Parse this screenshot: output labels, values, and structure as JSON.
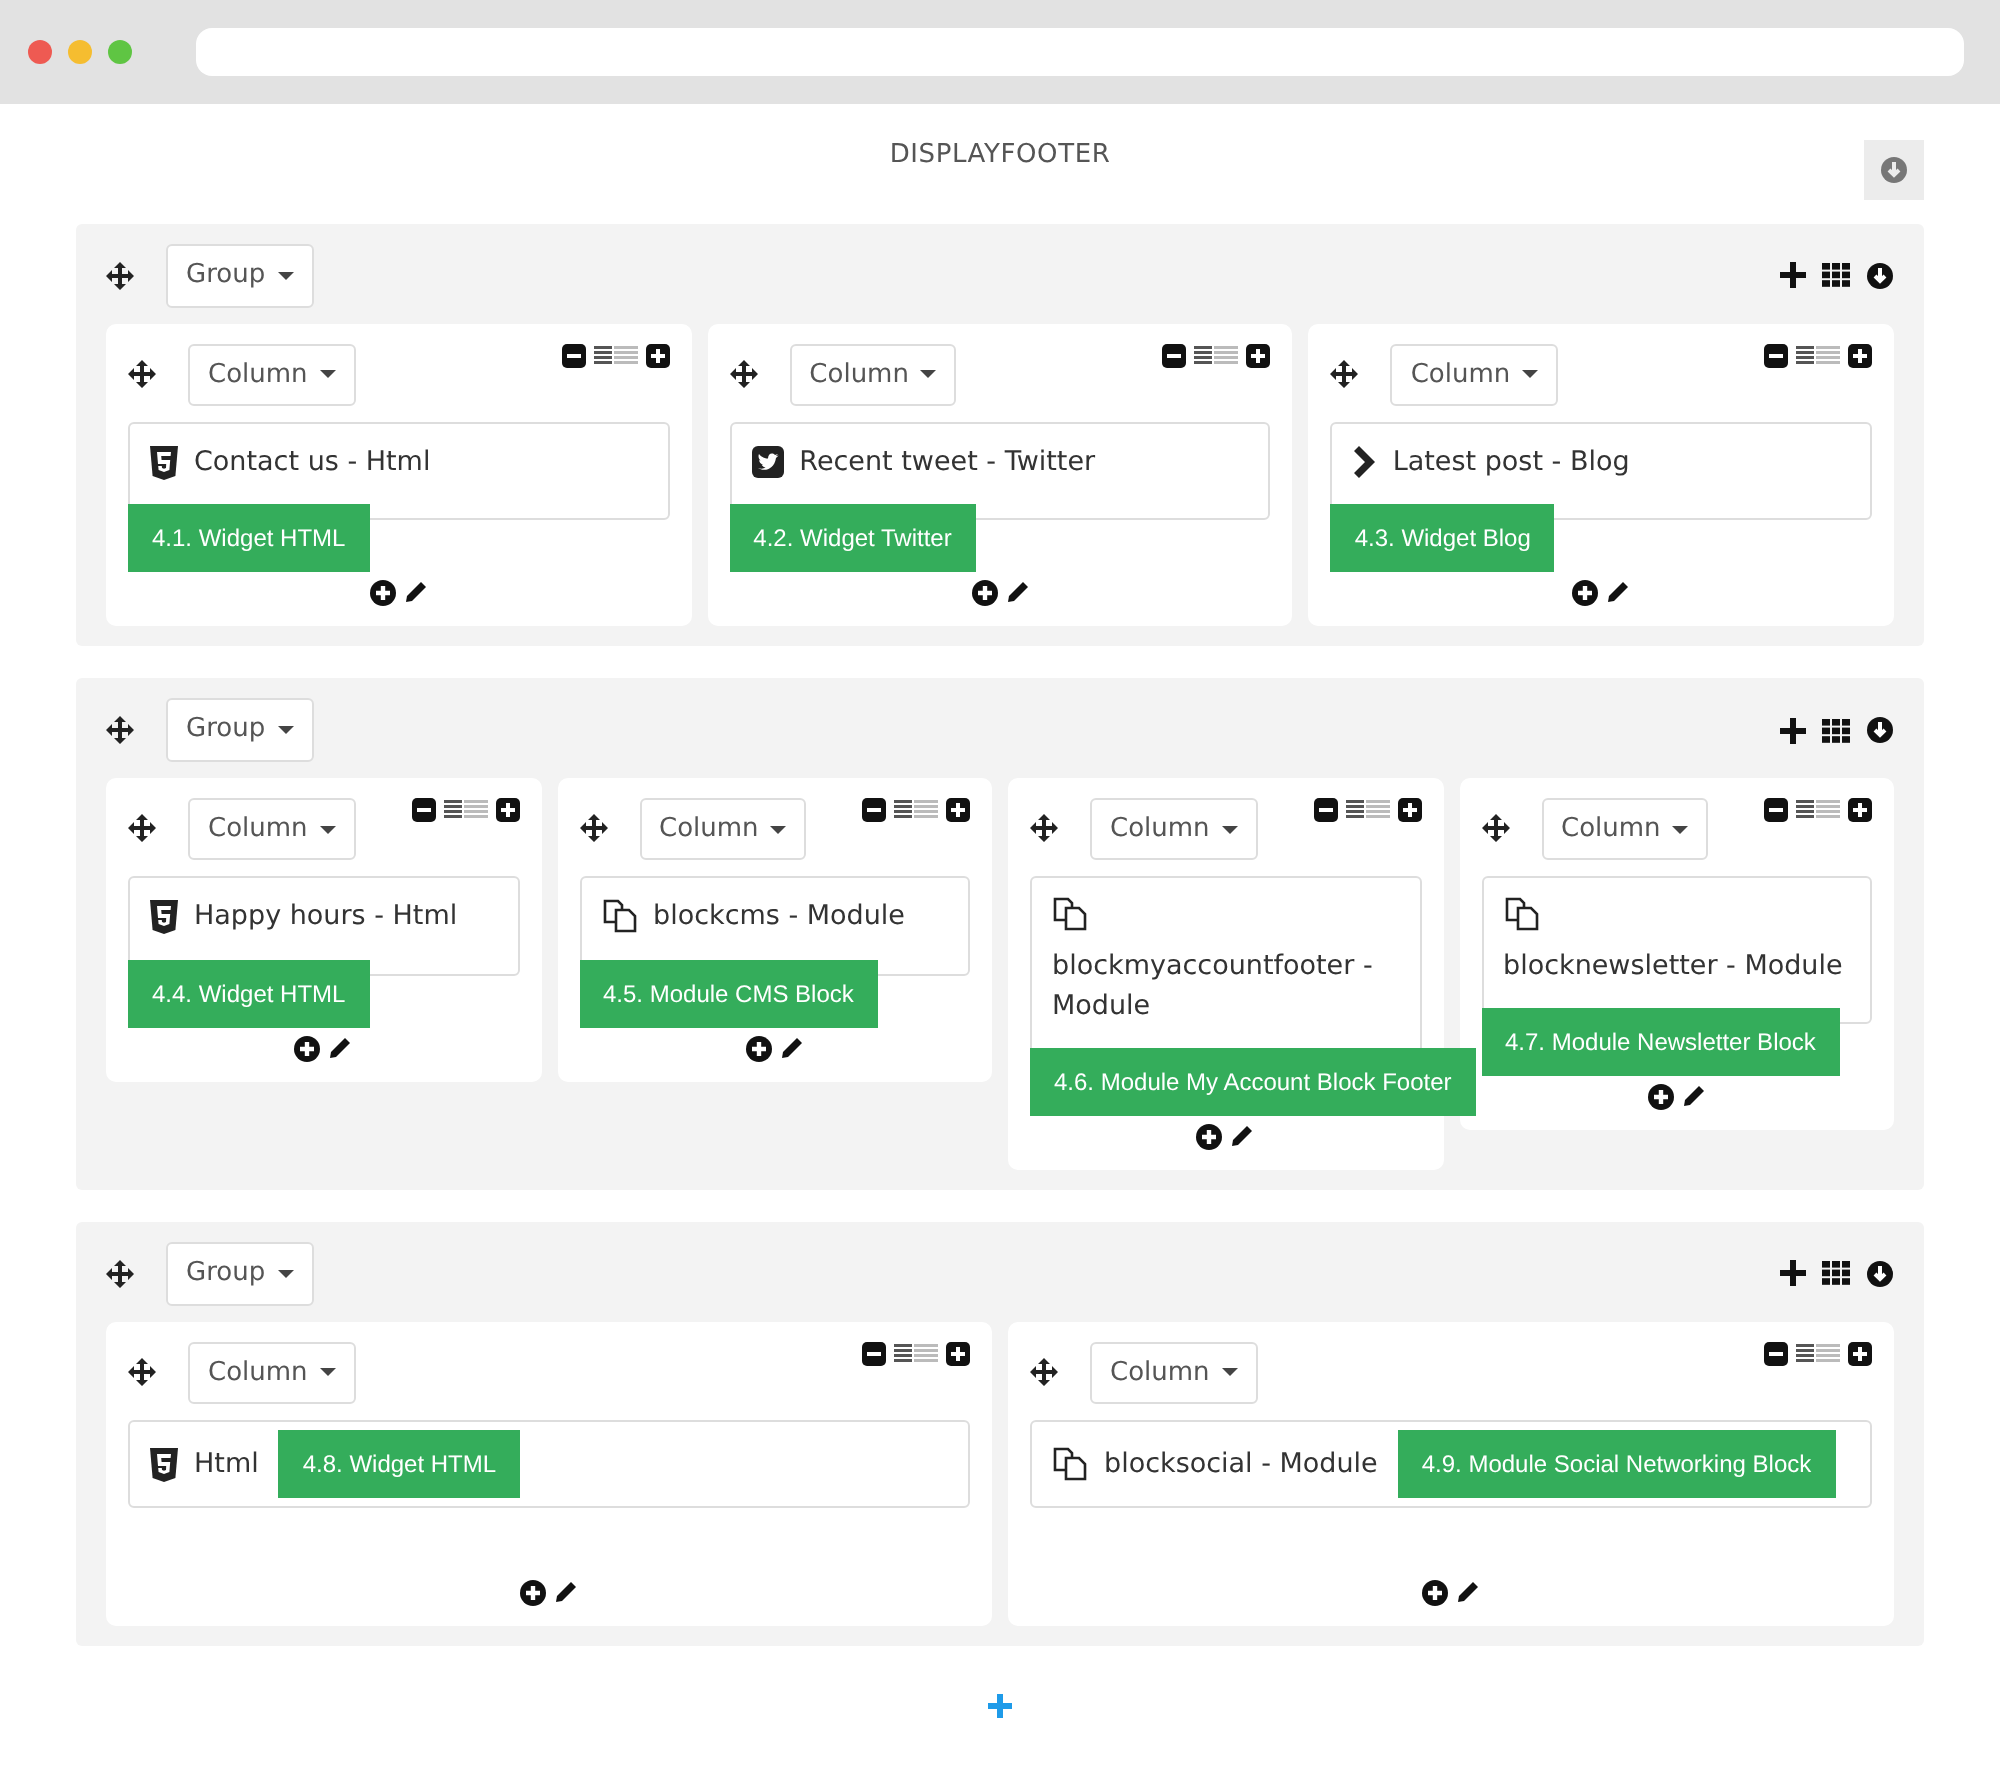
{
  "page": {
    "title": "DISPLAYFOOTER"
  },
  "groups": [
    {
      "label": "Group",
      "tags_inline": false,
      "columns": [
        {
          "label": "Column",
          "widgets": [
            {
              "kind": "html",
              "title": "Contact us - Html",
              "tag": "4.1. Widget HTML"
            }
          ]
        },
        {
          "label": "Column",
          "widgets": [
            {
              "kind": "twitter",
              "title": "Recent tweet - Twitter",
              "tag": "4.2. Widget Twitter"
            }
          ]
        },
        {
          "label": "Column",
          "widgets": [
            {
              "kind": "blog",
              "title": "Latest post - Blog",
              "tag": "4.3. Widget Blog"
            }
          ]
        }
      ]
    },
    {
      "label": "Group",
      "tags_inline": false,
      "columns": [
        {
          "label": "Column",
          "widgets": [
            {
              "kind": "html",
              "title": "Happy hours - Html",
              "tag": "4.4. Widget HTML"
            }
          ]
        },
        {
          "label": "Column",
          "widgets": [
            {
              "kind": "module",
              "title": "blockcms - Module",
              "tag": "4.5. Module CMS Block"
            }
          ]
        },
        {
          "label": "Column",
          "widgets": [
            {
              "kind": "module",
              "title": "blockmyaccountfooter - Module",
              "tag": "4.6. Module My Account Block Footer"
            }
          ]
        },
        {
          "label": "Column",
          "widgets": [
            {
              "kind": "module",
              "title": "blocknewsletter - Module",
              "tag": "4.7. Module Newsletter Block"
            }
          ]
        }
      ]
    },
    {
      "label": "Group",
      "tags_inline": true,
      "columns": [
        {
          "label": "Column",
          "widgets": [
            {
              "kind": "html",
              "title": "Html",
              "tag": "4.8. Widget HTML"
            }
          ]
        },
        {
          "label": "Column",
          "widgets": [
            {
              "kind": "module",
              "title": "blocksocial - Module",
              "tag": "4.9. Module Social Networking Block"
            }
          ]
        }
      ]
    }
  ]
}
